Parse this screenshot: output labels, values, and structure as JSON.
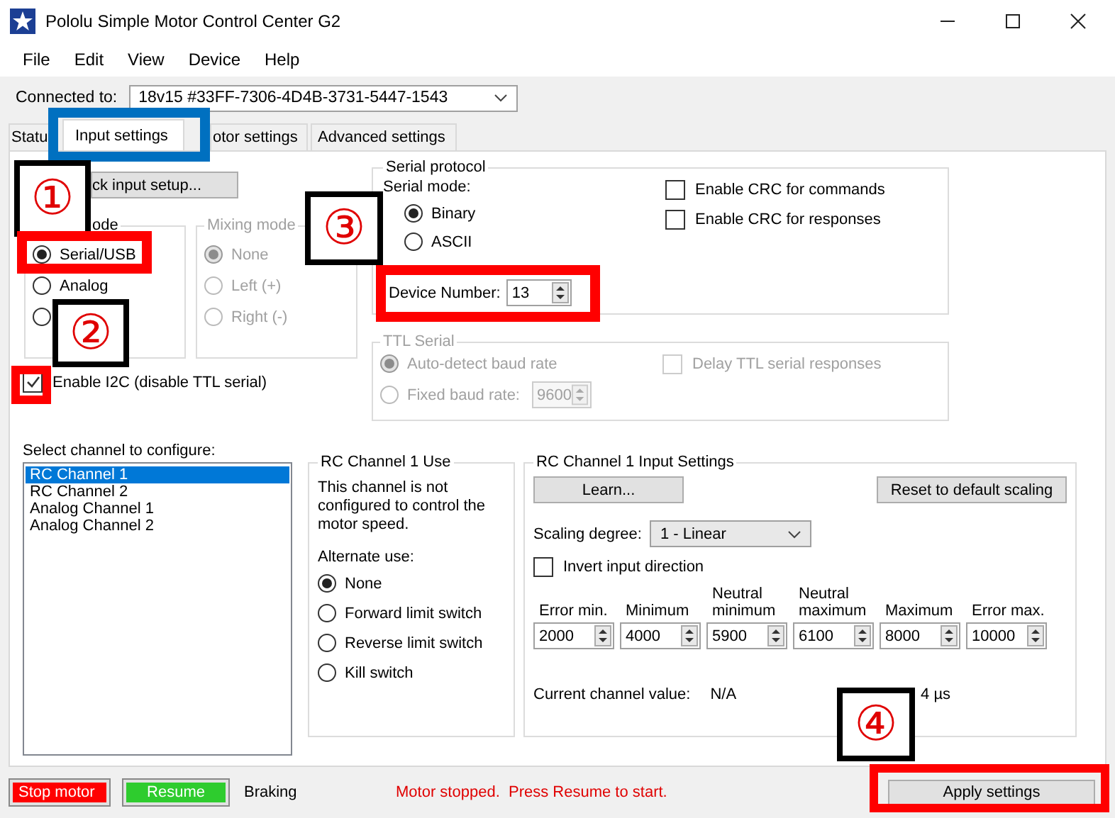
{
  "window": {
    "title": "Pololu Simple Motor Control Center G2"
  },
  "menu": [
    "File",
    "Edit",
    "View",
    "Device",
    "Help"
  ],
  "connection": {
    "label": "Connected to:",
    "device": "18v15 #33FF-7306-4D4B-3731-5447-1543"
  },
  "tabs": [
    {
      "label": "Statu",
      "selected": false
    },
    {
      "label": "Input settings",
      "selected": true
    },
    {
      "label": "otor settings",
      "selected": false
    },
    {
      "label": "Advanced settings",
      "selected": false
    }
  ],
  "quick_setup_button": "ck input setup...",
  "input_mode": {
    "legend": "ode",
    "options": [
      {
        "label": "Serial/USB",
        "selected": true
      },
      {
        "label": "Analog",
        "selected": false
      },
      {
        "selected": false
      }
    ]
  },
  "mixing_mode": {
    "legend": "Mixing mode",
    "disabled": true,
    "options": [
      {
        "label": "None",
        "selected": true
      },
      {
        "label": "Left (+)",
        "selected": false
      },
      {
        "label": "Right (-)",
        "selected": false
      }
    ]
  },
  "enable_i2c": {
    "label": "Enable I2C (disable TTL serial)",
    "checked": true
  },
  "serial_protocol": {
    "legend": "Serial protocol",
    "mode_label": "Serial mode:",
    "modes": [
      {
        "label": "Binary",
        "selected": true
      },
      {
        "label": "ASCII",
        "selected": false
      }
    ],
    "device_number_label": "Device Number:",
    "device_number": "13",
    "options": [
      {
        "label": "Enable CRC for commands",
        "checked": false
      },
      {
        "label": "Enable CRC for responses",
        "checked": false
      }
    ]
  },
  "ttl_serial": {
    "legend": "TTL Serial",
    "disabled": true,
    "baud_modes": [
      {
        "label": "Auto-detect baud rate",
        "selected": true
      },
      {
        "label": "Fixed baud rate:",
        "selected": false
      }
    ],
    "baud_rate": "9600",
    "delay": {
      "label": "Delay TTL serial responses",
      "checked": false
    }
  },
  "channel_list": {
    "label": "Select channel to configure:",
    "items": [
      {
        "label": "RC Channel 1",
        "selected": true
      },
      {
        "label": "RC Channel 2",
        "selected": false
      },
      {
        "label": "Analog Channel 1",
        "selected": false
      },
      {
        "label": "Analog Channel 2",
        "selected": false
      }
    ]
  },
  "channel_use": {
    "legend": "RC Channel 1 Use",
    "description": "This channel is not configured to control the motor speed.",
    "alternate_label": "Alternate use:",
    "options": [
      {
        "label": "None",
        "selected": true
      },
      {
        "label": "Forward limit switch",
        "selected": false
      },
      {
        "label": "Reverse limit switch",
        "selected": false
      },
      {
        "label": "Kill switch",
        "selected": false
      }
    ]
  },
  "input_settings": {
    "legend": "RC Channel 1 Input Settings",
    "learn_button": "Learn...",
    "reset_button": "Reset to default scaling",
    "scaling_label": "Scaling degree:",
    "scaling": "1 - Linear",
    "invert": {
      "label": "Invert input direction",
      "checked": false
    },
    "limits": [
      {
        "label": "Error min.",
        "value": "2000"
      },
      {
        "label": "Minimum",
        "value": "4000"
      },
      {
        "label": "Neutral minimum",
        "value": "5900"
      },
      {
        "label": "Neutral maximum",
        "value": "6100"
      },
      {
        "label": "Maximum",
        "value": "8000"
      },
      {
        "label": "Error max.",
        "value": "10000"
      }
    ],
    "current_label": "Current channel value:",
    "current_value": "N/A",
    "pulse": "4 µs"
  },
  "status_bar": {
    "stop_button": "Stop motor",
    "resume_button": "Resume",
    "state": "Braking",
    "message": "Motor stopped.  Press Resume to start.",
    "apply_button": "Apply settings"
  },
  "annotations": [
    {
      "kind": "highlight",
      "color": "#0070c0"
    },
    {
      "kind": "callout",
      "text": "①"
    },
    {
      "kind": "highlight",
      "color": "#ff0000"
    },
    {
      "kind": "callout",
      "text": "②"
    },
    {
      "kind": "highlight",
      "color": "#ff0000"
    },
    {
      "kind": "callout",
      "text": "③"
    },
    {
      "kind": "highlight",
      "color": "#ff0000"
    },
    {
      "kind": "callout",
      "text": "④"
    },
    {
      "kind": "highlight",
      "color": "#ff0000"
    }
  ]
}
